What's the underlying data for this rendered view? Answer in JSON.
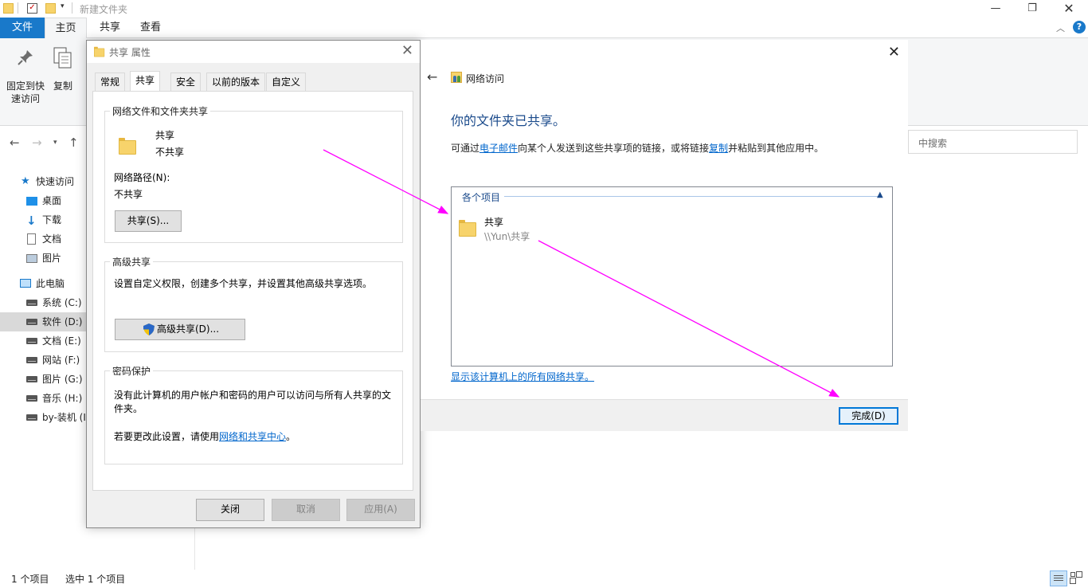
{
  "explorer": {
    "title": "新建文件夹",
    "ribbon_tabs": [
      "文件",
      "主页",
      "共享",
      "查看"
    ],
    "ribbon_buttons": {
      "pin": "固定到快速访问",
      "copy": "复制"
    },
    "search_placeholder": "中搜索",
    "sidebar": {
      "quick_access": "快速访问",
      "quick_items": [
        "桌面",
        "下载",
        "文档",
        "图片"
      ],
      "this_pc": "此电脑",
      "drives": [
        "系统 (C:)",
        "软件 (D:)",
        "文档 (E:)",
        "网站 (F:)",
        "图片 (G:)",
        "音乐 (H:)",
        "by-装机 (I"
      ]
    },
    "status": {
      "count": "1 个项目",
      "selected": "选中 1 个项目"
    }
  },
  "props": {
    "title": "共享 属性",
    "tabs": [
      "常规",
      "共享",
      "安全",
      "以前的版本",
      "自定义"
    ],
    "net_share_group": "网络文件和文件夹共享",
    "folder_name": "共享",
    "folder_state": "不共享",
    "net_path_label": "网络路径(N):",
    "net_path_value": "不共享",
    "share_button": "共享(S)...",
    "adv_group": "高级共享",
    "adv_desc": "设置自定义权限，创建多个共享，并设置其他高级共享选项。",
    "adv_button": "高级共享(D)...",
    "pwd_group": "密码保护",
    "pwd_desc": "没有此计算机的用户帐户和密码的用户可以访问与所有人共享的文件夹。",
    "pwd_change_prefix": "若要更改此设置，请使用",
    "pwd_change_link": "网络和共享中心",
    "pwd_change_suffix": "。",
    "buttons": {
      "close": "关闭",
      "cancel": "取消",
      "apply": "应用(A)"
    }
  },
  "wizard": {
    "title": "网络访问",
    "heading": "你的文件夹已共享。",
    "desc_1": "可通过",
    "desc_link_email": "电子邮件",
    "desc_2": "向某个人发送到这些共享项的链接，或将链接",
    "desc_link_copy": "复制",
    "desc_3": "并粘贴到其他应用中。",
    "list_header": "各个项目",
    "item_name": "共享",
    "item_path": "\\\\Yun\\共享",
    "show_all_link": "显示该计算机上的所有网络共享。",
    "done_button": "完成(D)"
  },
  "colors": {
    "accent": "#1979ca",
    "arrow": "#ff00ff",
    "link": "#0066cc"
  }
}
